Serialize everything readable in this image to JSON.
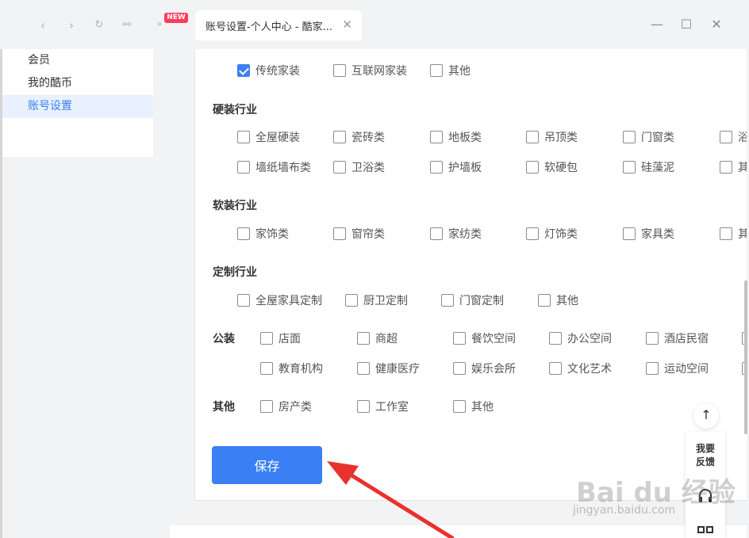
{
  "browser": {
    "tab_title": "账号设置-个人中心 - 酷家...",
    "new_badge": "NEW"
  },
  "sidebar": {
    "items": [
      {
        "label": "会员"
      },
      {
        "label": "我的酷币"
      },
      {
        "label": "账号设置"
      }
    ]
  },
  "top_row": [
    {
      "label": "传统家装",
      "checked": true
    },
    {
      "label": "互联网家装",
      "checked": false
    },
    {
      "label": "其他",
      "checked": false
    }
  ],
  "hard": {
    "title": "硬装行业",
    "row1": [
      "全屋硬装",
      "瓷砖类",
      "地板类",
      "吊顶类",
      "门窗类",
      "浴"
    ],
    "row2": [
      "墙纸墙布类",
      "卫浴类",
      "护墙板",
      "软硬包",
      "硅藻泥",
      "其"
    ]
  },
  "soft": {
    "title": "软装行业",
    "row1": [
      "家饰类",
      "窗帘类",
      "家纺类",
      "灯饰类",
      "家具类",
      "其"
    ]
  },
  "custom": {
    "title": "定制行业",
    "row1": [
      "全屋家具定制",
      "厨卫定制",
      "门窗定制",
      "其他"
    ]
  },
  "public": {
    "title": "公装",
    "row1": [
      "店面",
      "商超",
      "餐饮空间",
      "办公空间",
      "酒店民宿"
    ],
    "row2": [
      "教育机构",
      "健康医疗",
      "娱乐会所",
      "文化艺术",
      "运动空间"
    ]
  },
  "other": {
    "title": "其他",
    "row1": [
      "房产类",
      "工作室",
      "其他"
    ]
  },
  "save_label": "保存",
  "float": {
    "feedback_line1": "我要",
    "feedback_line2": "反馈"
  },
  "watermark": {
    "main": "Bai du 经验",
    "sub": "jingyan.baidu.com"
  },
  "colors": {
    "accent": "#3a7ff3",
    "arrow": "#e8322d"
  }
}
